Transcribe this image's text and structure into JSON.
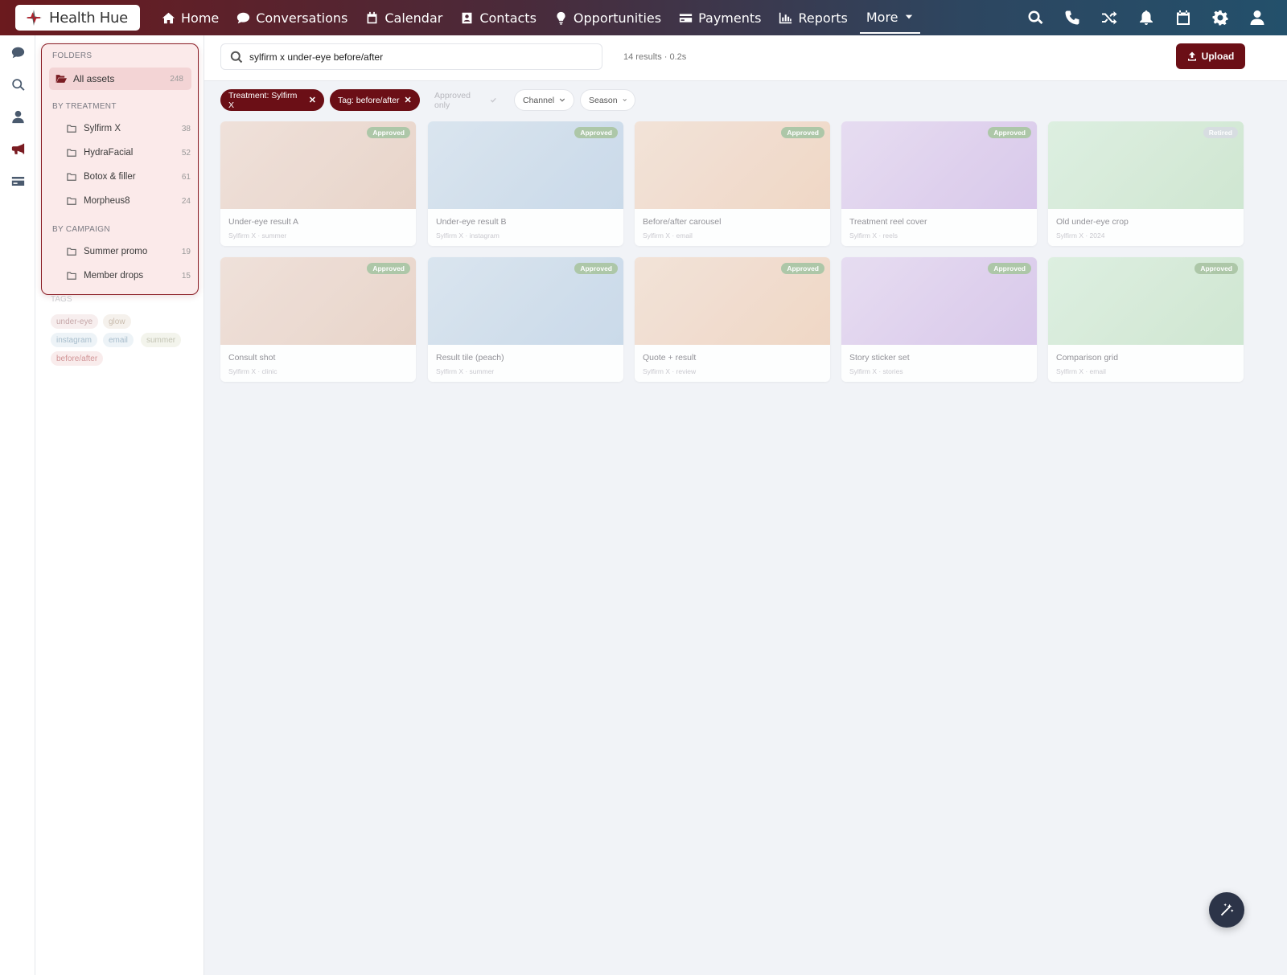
{
  "brand": {
    "name": "Health Hue"
  },
  "nav": {
    "items": [
      {
        "label": "Home",
        "icon": "home-icon"
      },
      {
        "label": "Conversations",
        "icon": "chat-icon"
      },
      {
        "label": "Calendar",
        "icon": "calendar-icon"
      },
      {
        "label": "Contacts",
        "icon": "contact-card-icon"
      },
      {
        "label": "Opportunities",
        "icon": "lightbulb-icon"
      },
      {
        "label": "Payments",
        "icon": "credit-card-icon"
      },
      {
        "label": "Reports",
        "icon": "bar-chart-icon"
      }
    ],
    "more_label": "More",
    "right_icons": [
      "search-icon",
      "phone-icon",
      "shuffle-icon",
      "bell-icon",
      "calendar-icon",
      "gear-icon",
      "user-icon"
    ]
  },
  "rail": {
    "icons": [
      "chat-icon",
      "search-icon",
      "user-icon",
      "megaphone-icon",
      "card-icon"
    ]
  },
  "sidebar": {
    "folders_title": "FOLDERS",
    "all_assets": {
      "label": "All assets",
      "count": "248"
    },
    "by_treatment_title": "BY TREATMENT",
    "treatments": [
      {
        "label": "Sylfirm X",
        "count": "38"
      },
      {
        "label": "HydraFacial",
        "count": "52"
      },
      {
        "label": "Botox & filler",
        "count": "61"
      },
      {
        "label": "Morpheus8",
        "count": "24"
      }
    ],
    "by_campaign_title": "BY CAMPAIGN",
    "campaigns": [
      {
        "label": "Summer promo",
        "count": "19"
      },
      {
        "label": "Member drops",
        "count": "15"
      }
    ],
    "tags_title": "TAGS",
    "tags": [
      "under-eye",
      "glow",
      "instagram",
      "email",
      "summer",
      "before/after"
    ]
  },
  "search": {
    "query": "sylfirm x under-eye before/after",
    "results": "14 results · 0.2s"
  },
  "upload_label": "Upload",
  "filters": {
    "active": [
      "Treatment: Sylfirm X",
      "Tag: before/after"
    ],
    "approved_only": "Approved only",
    "channel": "Channel",
    "season": "Season"
  },
  "assets": [
    {
      "title": "Under-eye result A",
      "meta": "Sylfirm X · summer",
      "status": "Approved"
    },
    {
      "title": "Under-eye result B",
      "meta": "Sylfirm X · instagram",
      "status": "Approved"
    },
    {
      "title": "Before/after carousel",
      "meta": "Sylfirm X · email",
      "status": "Approved"
    },
    {
      "title": "Treatment reel cover",
      "meta": "Sylfirm X · reels",
      "status": "Approved"
    },
    {
      "title": "Old under-eye crop",
      "meta": "Sylfirm X · 2024",
      "status": "Retired"
    },
    {
      "title": "Consult shot",
      "meta": "Sylfirm X · clinic",
      "status": "Approved"
    },
    {
      "title": "Result tile (peach)",
      "meta": "Sylfirm X · summer",
      "status": "Approved"
    },
    {
      "title": "Quote + result",
      "meta": "Sylfirm X · review",
      "status": "Approved"
    },
    {
      "title": "Story sticker set",
      "meta": "Sylfirm X · stories",
      "status": "Approved"
    },
    {
      "title": "Comparison grid",
      "meta": "Sylfirm X · email",
      "status": "Approved"
    }
  ],
  "colors": {
    "accent": "#6b0f16",
    "approved": "#a8c4a2",
    "retired": "#d5dce0",
    "thumb_peach": "#ecd6cc",
    "thumb_blue": "#c9d9ea",
    "thumb_apricot": "#f1d9c6",
    "thumb_lilac": "#dccbeb",
    "thumb_mint": "#d2e9d3"
  }
}
